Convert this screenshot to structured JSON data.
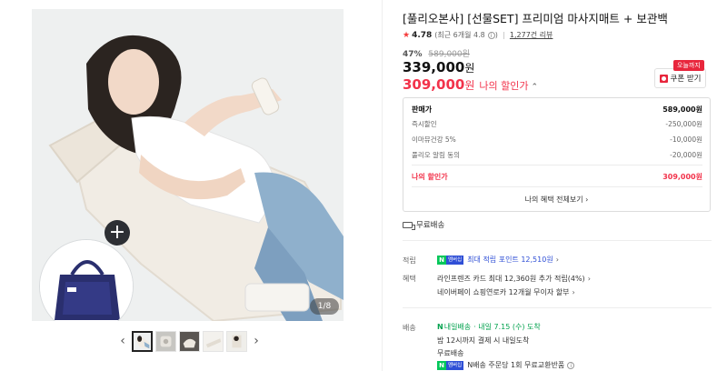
{
  "gallery": {
    "page_indicator": "1/8",
    "prev_label": "‹",
    "next_label": "›",
    "thumb_count": 5,
    "active_thumb": 1,
    "colors": {
      "bag": "#2a2f6e",
      "mat": "#f1ece4",
      "jeans": "#8fb0cc",
      "plus_bg": "#2d2f34"
    }
  },
  "product": {
    "title": "[풀리오본사] [선물SET] 프리미엄 마사지매트 + 보관백",
    "rating": "4.78",
    "rating_recent": "(최근 6개월 4.8",
    "review_count": "1,277건 리뷰",
    "discount_rate": "47%",
    "original_price": "589,000원",
    "sale_price": "339,000",
    "sale_price_unit": "원",
    "my_price": "309,000",
    "my_price_unit": "원",
    "my_price_label": "나의 할인가",
    "my_price_toggle": "⌃"
  },
  "coupon": {
    "today_badge": "오늘까지",
    "button_label": "쿠폰 받기",
    "accent_color": "#e8263c"
  },
  "price_breakdown": {
    "rows": [
      {
        "label": "판매가",
        "value": "589,000원"
      },
      {
        "label": "즉시할인",
        "value": "-250,000원"
      },
      {
        "label": "이마뮤건강 5%",
        "value": "-10,000원"
      },
      {
        "label": "풀리오 알림 동의",
        "value": "-20,000원"
      }
    ],
    "total_label": "나의 할인가",
    "total_value": "309,000원",
    "more_link": "나의 혜택 전체보기 ›"
  },
  "shipping_badge": "무료배송",
  "points": {
    "label": "적립",
    "npay_n": "N",
    "npay_m": "멤버십",
    "text": "최대 적립 포인트 12,510원",
    "chevron": "›"
  },
  "benefits": {
    "label": "혜택",
    "line1": "라인프렌즈 카드 최대 12,360원 추가 적립(4%)",
    "line1_chev": "›",
    "line2": "네이버페이 쇼핑연로카 12개월 무이자 할부",
    "line2_chev": "›"
  },
  "delivery": {
    "label": "배송",
    "tag_n": "N",
    "tag_text": "내일배송",
    "eta": "· 내일 7.15 (수) 도착",
    "line2": "밤 12시까지 결제 시 내일도착",
    "line3": "무료배송",
    "npay_n": "N",
    "npay_m": "멤버십",
    "line4": "N배송 주문당 1회 무료교환반품",
    "info_icon": "i"
  }
}
